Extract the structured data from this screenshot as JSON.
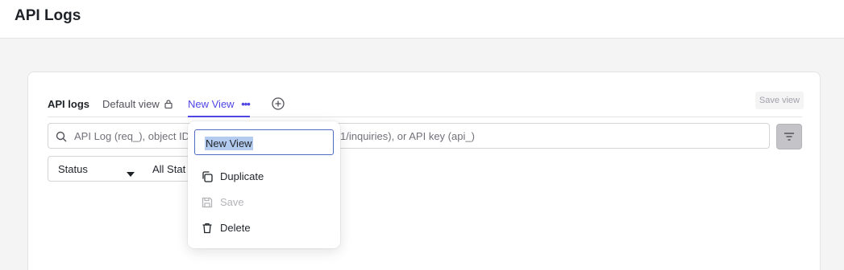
{
  "header": {
    "title": "API Logs"
  },
  "tabs": {
    "api_logs": "API logs",
    "default_view": "Default view",
    "new_view": "New View",
    "save_view": "Save view"
  },
  "search": {
    "placeholder_left": "API Log (req_), object ID",
    "placeholder_right": "1/inquiries), or API key (api_)"
  },
  "filters": {
    "status_label": "Status",
    "status_value": "All Stat"
  },
  "view_menu": {
    "name_value": "New View",
    "items": [
      {
        "label": "Duplicate",
        "icon": "duplicate-icon",
        "enabled": true
      },
      {
        "label": "Save",
        "icon": "save-icon",
        "enabled": false
      },
      {
        "label": "Delete",
        "icon": "trash-icon",
        "enabled": true
      }
    ]
  },
  "colors": {
    "accent": "#4f46e5",
    "selection": "#b4cbf0",
    "disabled": "#b4b4b8"
  }
}
